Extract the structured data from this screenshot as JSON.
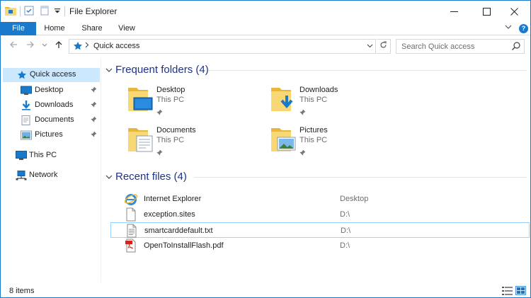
{
  "window": {
    "title": "File Explorer"
  },
  "ribbon": {
    "tabs": [
      {
        "label": "File"
      },
      {
        "label": "Home"
      },
      {
        "label": "Share"
      },
      {
        "label": "View"
      }
    ],
    "help_label": "?"
  },
  "address_bar": {
    "path": [
      "Quick access"
    ],
    "search_placeholder": "Search Quick access"
  },
  "nav_pane": {
    "items": [
      {
        "label": "Quick access",
        "icon": "star-icon",
        "selected": true
      },
      {
        "label": "Desktop",
        "icon": "desktop-icon",
        "pinned": true
      },
      {
        "label": "Downloads",
        "icon": "downloads-icon",
        "pinned": true
      },
      {
        "label": "Documents",
        "icon": "documents-icon",
        "pinned": true
      },
      {
        "label": "Pictures",
        "icon": "pictures-icon",
        "pinned": true
      },
      {
        "label": "This PC",
        "icon": "computer-icon"
      },
      {
        "label": "Network",
        "icon": "network-icon"
      }
    ]
  },
  "frequent_folders": {
    "title": "Frequent folders (4)",
    "items": [
      {
        "name": "Desktop",
        "location": "This PC",
        "icon": "desktop-folder-icon"
      },
      {
        "name": "Downloads",
        "location": "This PC",
        "icon": "downloads-folder-icon"
      },
      {
        "name": "Documents",
        "location": "This PC",
        "icon": "documents-folder-icon"
      },
      {
        "name": "Pictures",
        "location": "This PC",
        "icon": "pictures-folder-icon"
      }
    ]
  },
  "recent_files": {
    "title": "Recent files (4)",
    "items": [
      {
        "name": "Internet Explorer",
        "location": "Desktop",
        "icon": "internet-explorer-icon"
      },
      {
        "name": "exception.sites",
        "location": "D:\\",
        "icon": "blank-file-icon"
      },
      {
        "name": "smartcarddefault.txt",
        "location": "D:\\",
        "icon": "text-file-icon",
        "selected": true
      },
      {
        "name": "OpenToInstallFlash.pdf",
        "location": "D:\\",
        "icon": "pdf-file-icon"
      }
    ]
  },
  "status_bar": {
    "text": "8 items"
  },
  "colors": {
    "accent": "#1979ca",
    "selection": "#cce8ff",
    "group_title": "#1e3287",
    "folder": "#f8d775"
  }
}
